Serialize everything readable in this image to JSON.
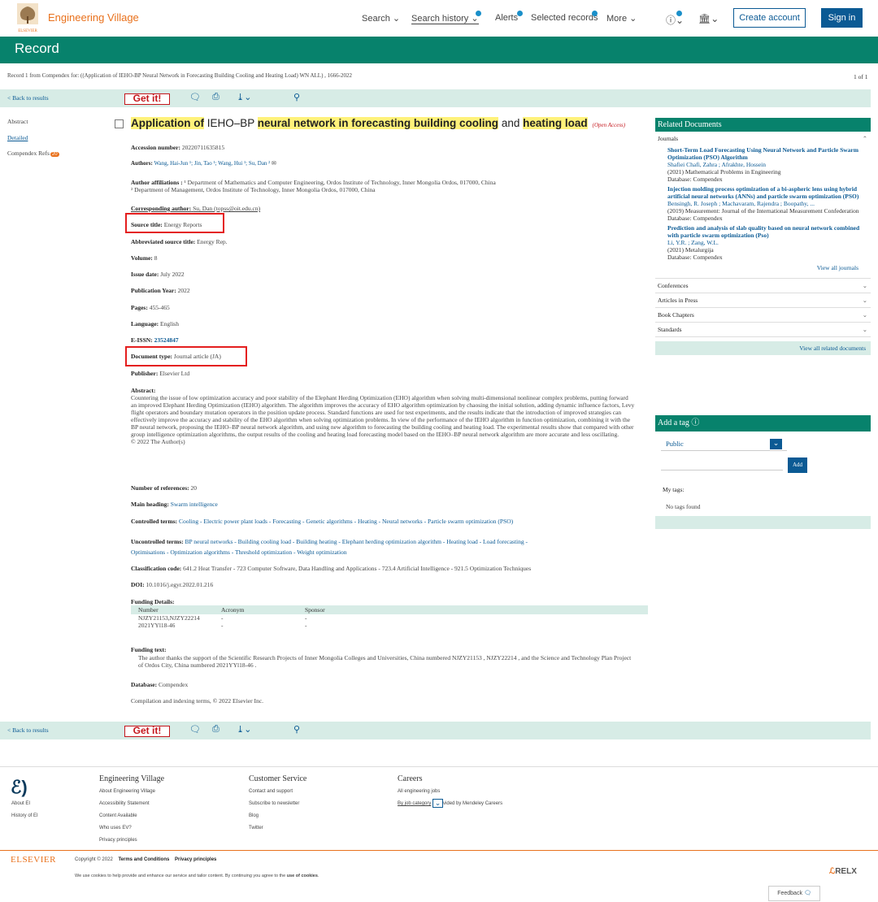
{
  "header": {
    "brand": "Engineering Village",
    "elsevier_small": "ELSEVIER",
    "nav": [
      "Search",
      "Search history",
      "Alerts",
      "Selected records",
      "More"
    ],
    "create_account": "Create account",
    "sign_in": "Sign in"
  },
  "page_title": "Record",
  "record_line": "Record 1 from Compendex for: ((Application of IEHO-BP Neural Network in Forecasting Building Cooling and Heating Load) WN ALL) , 1666-2022",
  "record_count": "1 of 1",
  "back_to_results": "< Back to results",
  "get_it": "Get it!",
  "side_nav": {
    "abstract": "Abstract",
    "detailed": "Detailed",
    "refs": "Compendex Refs",
    "refs_count": "20"
  },
  "article": {
    "title_parts": [
      "Application of",
      " IEHO–BP ",
      "neural network in forecasting building cooling",
      " and ",
      "heating load"
    ],
    "open_access": "(Open Access)"
  },
  "fields": {
    "accession_label": "Accession number:",
    "accession": "20220711635815",
    "authors_label": "Authors:",
    "authors": "Wang, Hai-Jun ¹; Jin, Tao ¹; Wang, Hui ¹; Su, Dan ²",
    "aff_label": "Author affiliations :",
    "aff1": "¹ Department of Mathematics and Computer Engineering, Ordos Institute of Technology, Inner Mongolia Ordos, 017000, China",
    "aff2": "² Department of Management, Ordos Institute of Technology, Inner Mongolia Ordos, 017000, China",
    "corr_label": "Corresponding author:",
    "corr": "Su, Dan (topss@oit.edu.cn)",
    "source_label": "Source title:",
    "source": "Energy Reports",
    "abbr_label": "Abbreviated source title:",
    "abbr": "Energy Rep.",
    "volume_label": "Volume:",
    "volume": "8",
    "issue_label": "Issue date:",
    "issue": "July 2022",
    "year_label": "Publication Year:",
    "year": "2022",
    "pages_label": "Pages:",
    "pages": "455-465",
    "lang_label": "Language:",
    "lang": "English",
    "eissn_label": "E-ISSN:",
    "eissn": "23524847",
    "doctype_label": "Document type:",
    "doctype": "Journal article (JA)",
    "publisher_label": "Publisher:",
    "publisher": "Elsevier Ltd",
    "abstract_label": "Abstract:",
    "abstract": "Countering the issue of low optimization accuracy and poor stability of the Elephant Herding Optimization (EHO) algorithm when solving multi-dimensional nonlinear complex problems, putting forward an improved Elephant Herding Optimization (IEHO) algorithm. The algorithm improves the accuracy of EHO algorithm optimization by chaosing the initial solution, adding dynamic influence factors, Levy flight operators and boundary mutation operators in the position update process. Standard functions are used for test experiments, and the results indicate that the introduction of improved strategies can effectively improve the accuracy and stability of the EHO algorithm when solving optimization problems. In view of the performance of the IEHO algorithm in function optimization, combining it with the BP neural network, proposing the IEHO–BP neural network algorithm, and using new algorithm to forecasting the building cooling and heating load. The experimental results show that compared with other group intelligence optimization algorithms, the output results of the cooling and heating load forecasting model based on the IEHO–BP neural network algorithm are more accurate and less oscillating.",
    "copyright": "© 2022 The Author(s)",
    "refs_label": "Number of references:",
    "refs": "20",
    "main_heading_label": "Main heading:",
    "main_heading": "Swarm intelligence",
    "controlled_label": "Controlled terms:",
    "controlled": "Cooling - Electric power plant loads - Forecasting - Genetic algorithms - Heating - Neural networks - Particle swarm optimization (PSO)",
    "uncontrolled_label": "Uncontrolled terms:",
    "uncontrolled1": "BP neural networks - Building cooling load - Building heating - Elephant herding optimization algorithm - Heating load - Load forecasting -",
    "uncontrolled2": "Optimisations - Optimization algorithms - Threshold optimization - Weight optimization",
    "class_label": "Classification code:",
    "class": "641.2 Heat Transfer - 723 Computer Software, Data Handling and Applications - 723.4 Artificial Intelligence - 921.5 Optimization Techniques",
    "doi_label": "DOI:",
    "doi": "10.1016/j.egyr.2022.01.216",
    "funding_label": "Funding Details:",
    "funding_headers": [
      "Number",
      "Acronym",
      "Sponsor"
    ],
    "funding_rows": [
      [
        "NJZY21153,NJZY22214",
        "-",
        "-"
      ],
      [
        "2021YYl18-46",
        "-",
        "-"
      ]
    ],
    "funding_text_label": "Funding text:",
    "funding_text": "The author thanks the support of the Scientific Research Projects of Inner Mongolia Colleges and Universities, China numbered NJZY21153 , NJZY22214 , and the Science and Technology Plan Project of Ordos City, China numbered 2021YYl18-46 .",
    "db_label": "Database:",
    "db": "Compendex",
    "compilation": "Compilation and indexing terms, © 2022 Elsevier Inc."
  },
  "related": {
    "heading": "Related Documents",
    "journals_label": "Journals",
    "items": [
      {
        "title": "Short-Term Load Forecasting Using Neural Network and Particle Swarm Optimization (PSO) Algorithm",
        "authors": "Shafiei Chafi, Zahra ; Afrakhte, Hossein",
        "source": "(2021) Mathematical Problems in Engineering",
        "db": "Database: Compendex"
      },
      {
        "title": "Injection molding process optimization of a bi-aspheric lens using hybrid artificial neural networks (ANNs) and particle swarm optimization (PSO)",
        "authors": "Bensingh, R. Joseph ; Machavaram, Rajendra ; Boopathy, ...",
        "source": "(2019) Measurement: Journal of the International Measurement Confederation",
        "db": "Database: Compendex"
      },
      {
        "title": "Prediction and analysis of slab quality based on neural network combined with particle swarm optimization (Pso)",
        "authors": "Li, Y.R. ; Zang, W.L.",
        "source": "(2021) Metalurgija",
        "db": "Database: Compendex"
      }
    ],
    "view_all_journals": "View all journals",
    "sections": [
      "Conferences",
      "Articles in Press",
      "Book Chapters",
      "Standards"
    ],
    "view_all_related": "View all related documents"
  },
  "tag": {
    "heading": "Add a tag",
    "select": "Public",
    "add": "Add",
    "my_tags": "My tags:",
    "no_tags": "No tags found"
  },
  "footer": {
    "ei": {
      "about": "About EI",
      "history": "History of EI"
    },
    "ev": {
      "heading": "Engineering Village",
      "links": [
        "About Engineering Village",
        "Accessibility Statement",
        "Content Available",
        "Who uses EV?",
        "Privacy principles"
      ]
    },
    "cs": {
      "heading": "Customer Service",
      "links": [
        "Contact and support",
        "Subscribe to newsletter",
        "Blog",
        "Twitter"
      ]
    },
    "careers": {
      "heading": "Careers",
      "links": [
        "All engineering jobs",
        "By job category",
        "vided by Mendeley Careers"
      ]
    },
    "elsevier": "ELSEVIER",
    "copyright": "Copyright © 2022",
    "terms": "Terms and Conditions",
    "privacy": "Privacy principles",
    "cookies_start": "We use cookies to help provide and enhance our service and tailor content. By continuing you agree to the",
    "cookies_link": "use of cookies",
    "relx": "RELX",
    "feedback": "Feedback"
  }
}
